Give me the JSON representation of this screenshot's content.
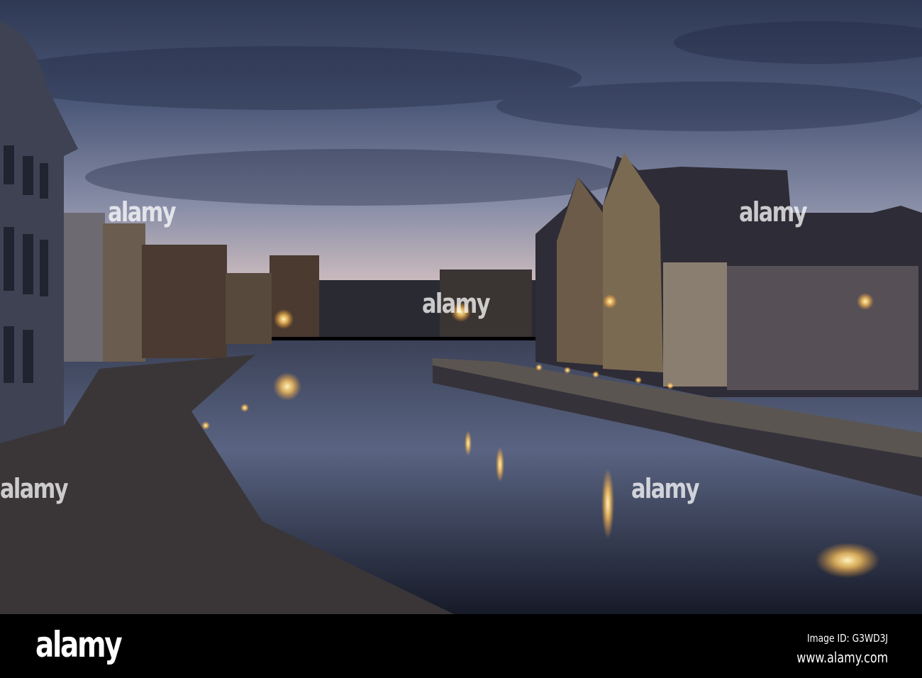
{
  "photo": {
    "subject": "Graslei canal at dusk",
    "colors": {
      "sky_top": "#39435f",
      "sky_horizon": "#d8c3c4",
      "water": "#1b2032",
      "light": "#ffd27a"
    }
  },
  "watermark": {
    "text": "alamy"
  },
  "footer": {
    "logo": "alamy",
    "image_id": "Image ID: G3WD3J",
    "website": "www.alamy.com"
  }
}
